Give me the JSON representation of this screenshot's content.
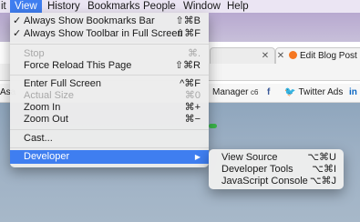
{
  "menubar": {
    "items": [
      {
        "label": "it"
      },
      {
        "label": "View"
      },
      {
        "label": "History"
      },
      {
        "label": "Bookmarks"
      },
      {
        "label": "People"
      },
      {
        "label": "Window"
      },
      {
        "label": "Help"
      }
    ]
  },
  "view_menu": {
    "items": [
      {
        "check": "✓",
        "label": "Always Show Bookmarks Bar",
        "shortcut": "⇧⌘B"
      },
      {
        "check": "✓",
        "label": "Always Show Toolbar in Full Screen",
        "shortcut": "⇧⌘F"
      },
      {
        "label": "Stop",
        "shortcut": "⌘."
      },
      {
        "label": "Force Reload This Page",
        "shortcut": "⇧⌘R"
      },
      {
        "label": "Enter Full Screen",
        "shortcut": "^⌘F"
      },
      {
        "label": "Actual Size",
        "shortcut": "⌘0"
      },
      {
        "label": "Zoom In",
        "shortcut": "⌘+"
      },
      {
        "label": "Zoom Out",
        "shortcut": "⌘−"
      },
      {
        "label": "Cast..."
      },
      {
        "label": "Developer",
        "arrow": "▶"
      }
    ]
  },
  "developer_menu": {
    "items": [
      {
        "label": "View Source",
        "shortcut": "⌥⌘U"
      },
      {
        "label": "Developer Tools",
        "shortcut": "⌥⌘I"
      },
      {
        "label": "JavaScript Console",
        "shortcut": "⌥⌘J"
      }
    ]
  },
  "browser": {
    "tabs": [
      {
        "close": "✕"
      },
      {
        "close": "✕",
        "title": "Edit Blog Post | Ren"
      }
    ],
    "bookmarks": {
      "asa": "Asa",
      "manager": "Manager",
      "c6": "c6",
      "fb": "f",
      "twitter": "Twitter Ads",
      "linkedin": "in"
    }
  }
}
